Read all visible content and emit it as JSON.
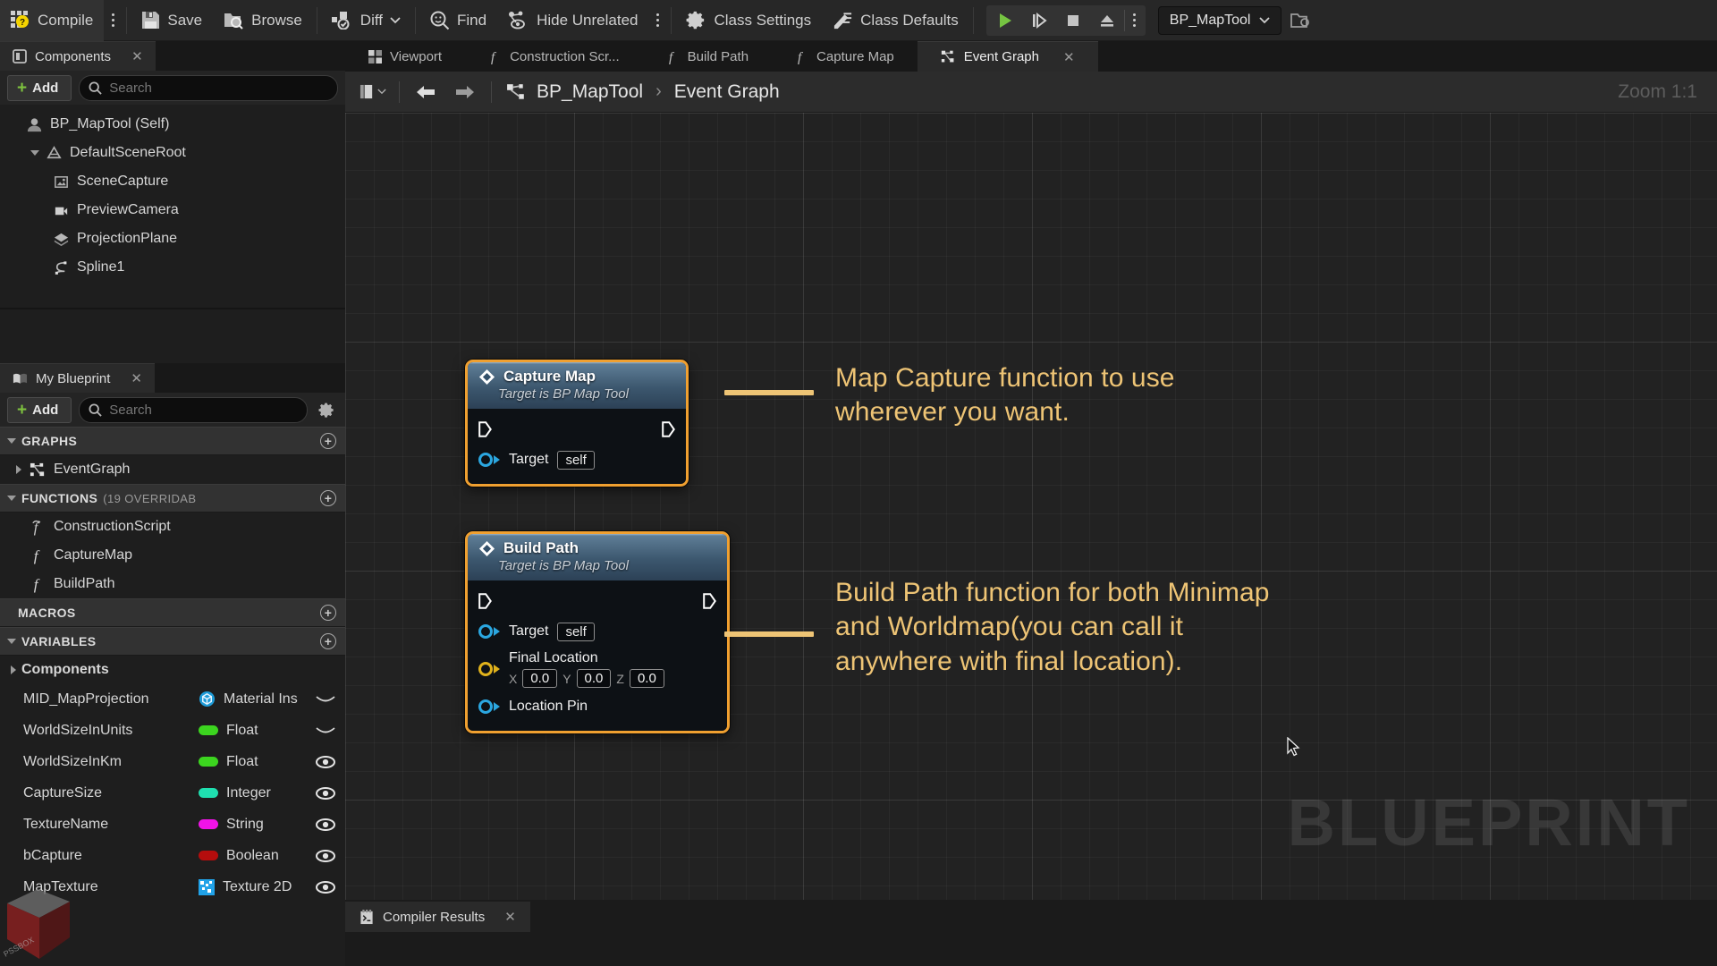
{
  "toolbar": {
    "compile": "Compile",
    "save": "Save",
    "browse": "Browse",
    "diff": "Diff",
    "find": "Find",
    "hide_unrelated": "Hide Unrelated",
    "class_settings": "Class Settings",
    "class_defaults": "Class Defaults",
    "blueprint_selector": "BP_MapTool"
  },
  "components_panel": {
    "tab_label": "Components",
    "add_label": "Add",
    "search_placeholder": "Search",
    "items": [
      {
        "label": "BP_MapTool (Self)",
        "icon": "actor-icon",
        "indent": 0,
        "arrow": "none"
      },
      {
        "label": "DefaultSceneRoot",
        "icon": "scene-root-icon",
        "indent": 1,
        "arrow": "down"
      },
      {
        "label": "SceneCapture",
        "icon": "scene-capture-icon",
        "indent": 2,
        "arrow": "none"
      },
      {
        "label": "PreviewCamera",
        "icon": "camera-icon",
        "indent": 2,
        "arrow": "none"
      },
      {
        "label": "ProjectionPlane",
        "icon": "plane-icon",
        "indent": 2,
        "arrow": "none"
      },
      {
        "label": "Spline1",
        "icon": "spline-icon",
        "indent": 2,
        "arrow": "none"
      }
    ]
  },
  "myblueprint_panel": {
    "tab_label": "My Blueprint",
    "add_label": "Add",
    "search_placeholder": "Search",
    "sections": {
      "graphs": {
        "title": "GRAPHS",
        "expanded": true
      },
      "functions": {
        "title": "FUNCTIONS",
        "count": "(19 OVERRIDAB",
        "expanded": true
      },
      "macros": {
        "title": "MACROS",
        "expanded": false
      },
      "variables": {
        "title": "VARIABLES",
        "expanded": true
      }
    },
    "graphs": [
      {
        "label": "EventGraph",
        "icon": "event-graph-icon"
      }
    ],
    "functions": [
      {
        "label": "ConstructionScript",
        "icon": "construction-script-icon"
      },
      {
        "label": "CaptureMap",
        "icon": "function-icon"
      },
      {
        "label": "BuildPath",
        "icon": "function-icon"
      }
    ],
    "variable_groups": [
      {
        "label": "Components",
        "arrow": "right"
      }
    ],
    "variables": [
      {
        "name": "MID_MapProjection",
        "type": "Material Ins",
        "color": "#1e9bd7",
        "icon": "object-icon",
        "visible": false
      },
      {
        "name": "WorldSizeInUnits",
        "type": "Float",
        "color": "#3cd51f",
        "icon": "pill",
        "visible": false
      },
      {
        "name": "WorldSizeInKm",
        "type": "Float",
        "color": "#3cd51f",
        "icon": "pill",
        "visible": true
      },
      {
        "name": "CaptureSize",
        "type": "Integer",
        "color": "#1fe0b0",
        "icon": "pill",
        "visible": true
      },
      {
        "name": "TextureName",
        "type": "String",
        "color": "#f113e8",
        "icon": "pill",
        "visible": true
      },
      {
        "name": "bCapture",
        "type": "Boolean",
        "color": "#b50d0d",
        "icon": "pill",
        "visible": true
      },
      {
        "name": "MapTexture",
        "type": "Texture 2D",
        "color": "#21a2e8",
        "icon": "texture-icon",
        "visible": true
      }
    ]
  },
  "graph_tabs": [
    {
      "label": "Viewport",
      "icon": "viewport-icon",
      "active": false
    },
    {
      "label": "Construction Scr...",
      "icon": "function-icon",
      "active": false
    },
    {
      "label": "Build Path",
      "icon": "function-icon",
      "active": false
    },
    {
      "label": "Capture Map",
      "icon": "function-icon",
      "active": false
    },
    {
      "label": "Event Graph",
      "icon": "event-graph-icon",
      "active": true
    }
  ],
  "breadcrumb": {
    "root": "BP_MapTool",
    "separator": "›",
    "current": "Event Graph",
    "zoom": "Zoom 1:1"
  },
  "nodes": [
    {
      "title": "Capture Map",
      "subtitle": "Target is BP Map Tool",
      "target_label": "Target",
      "target_value": "self"
    },
    {
      "title": "Build Path",
      "subtitle": "Target is BP Map Tool",
      "target_label": "Target",
      "target_value": "self",
      "vector_label": "Final Location",
      "vector": {
        "x_label": "X",
        "x": "0.0",
        "y_label": "Y",
        "y": "0.0",
        "z_label": "Z",
        "z": "0.0"
      },
      "location_pin_label": "Location Pin"
    }
  ],
  "annotations": [
    {
      "text": "Map Capture function to use\nwherever you want."
    },
    {
      "text": "Build Path function for both Minimap\nand Worldmap(you can call it\nanywhere with final location)."
    }
  ],
  "watermark": "BLUEPRINT",
  "compiler": {
    "tab_label": "Compiler Results"
  },
  "colors": {
    "accent_orange": "#f0a030",
    "annotation": "#eec475",
    "exec_white": "#ffffff",
    "object_blue": "#2ba7e0",
    "struct_yellow": "#e0b21c",
    "add_green": "#7ec23f"
  }
}
